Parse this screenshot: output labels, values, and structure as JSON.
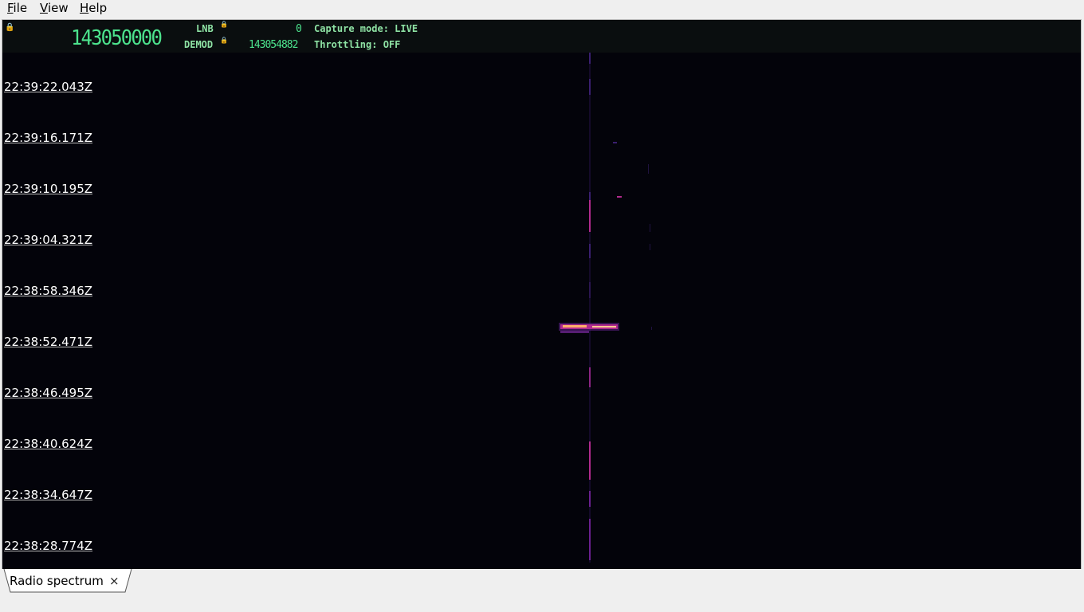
{
  "menu": {
    "file": {
      "mnemonic": "F",
      "rest": "ile"
    },
    "view": {
      "mnemonic": "V",
      "rest": "iew"
    },
    "help": {
      "mnemonic": "H",
      "rest": "elp"
    }
  },
  "header": {
    "main_frequency": "143050000",
    "lnb_label": "LNB",
    "lnb_value": "0",
    "demod_label": "DEMOD",
    "demod_value": "143054882",
    "capture_mode": "Capture mode: LIVE",
    "throttling": "Throttling: OFF"
  },
  "waterfall": {
    "timestamps": [
      "22:39:22.043Z",
      "22:39:16.171Z",
      "22:39:10.195Z",
      "22:39:04.321Z",
      "22:38:58.346Z",
      "22:38:52.471Z",
      "22:38:46.495Z",
      "22:38:40.624Z",
      "22:38:34.647Z",
      "22:38:28.774Z"
    ],
    "colors": {
      "background": "#03030a",
      "weak_signal": "#3a1f70",
      "medium_signal": "#b02a8f",
      "strong_signal": "#ffb06a"
    }
  },
  "tab": {
    "label": "Radio spectrum",
    "close_glyph": "×"
  }
}
